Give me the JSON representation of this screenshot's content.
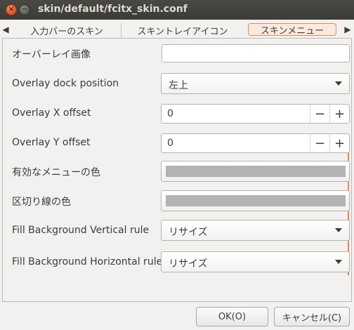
{
  "window": {
    "title": "skin/default/fcitx_skin.conf"
  },
  "titlebar": {
    "close_glyph": "×",
    "minimize_glyph": "−"
  },
  "tabs": [
    {
      "label": "入力バーのスキン",
      "selected": false
    },
    {
      "label": "スキントレイアイコン",
      "selected": false
    },
    {
      "label": "スキンメニュー",
      "selected": true
    }
  ],
  "tab_scroll": {
    "left_glyph": "◀",
    "right_glyph": "▶"
  },
  "form": {
    "rows": [
      {
        "label": "オーバーレイ画像",
        "control": "text",
        "value": ""
      },
      {
        "label": "Overlay dock position",
        "control": "combo",
        "value": "左上"
      },
      {
        "label": "Overlay X offset",
        "control": "spin",
        "value": "0"
      },
      {
        "label": "Overlay Y offset",
        "control": "spin",
        "value": "0"
      },
      {
        "label": "有効なメニューの色",
        "control": "color",
        "value": "#b3b3b3"
      },
      {
        "label": "区切り線の色",
        "control": "color",
        "value": "#b3b3b3"
      },
      {
        "label": "Fill Background Vertical rule",
        "control": "combo",
        "value": "リサイズ"
      },
      {
        "label": "Fill Background Horizontal rule",
        "control": "combo",
        "value": "リサイズ"
      }
    ],
    "spin_minus": "−",
    "spin_plus": "+"
  },
  "buttons": {
    "ok_label": "OK(O)",
    "cancel_label": "キャンセル(C)"
  },
  "colors": {
    "accent": "#e5884f",
    "titlebar": "#3c3b37",
    "swatch": "#b3b3b3"
  }
}
